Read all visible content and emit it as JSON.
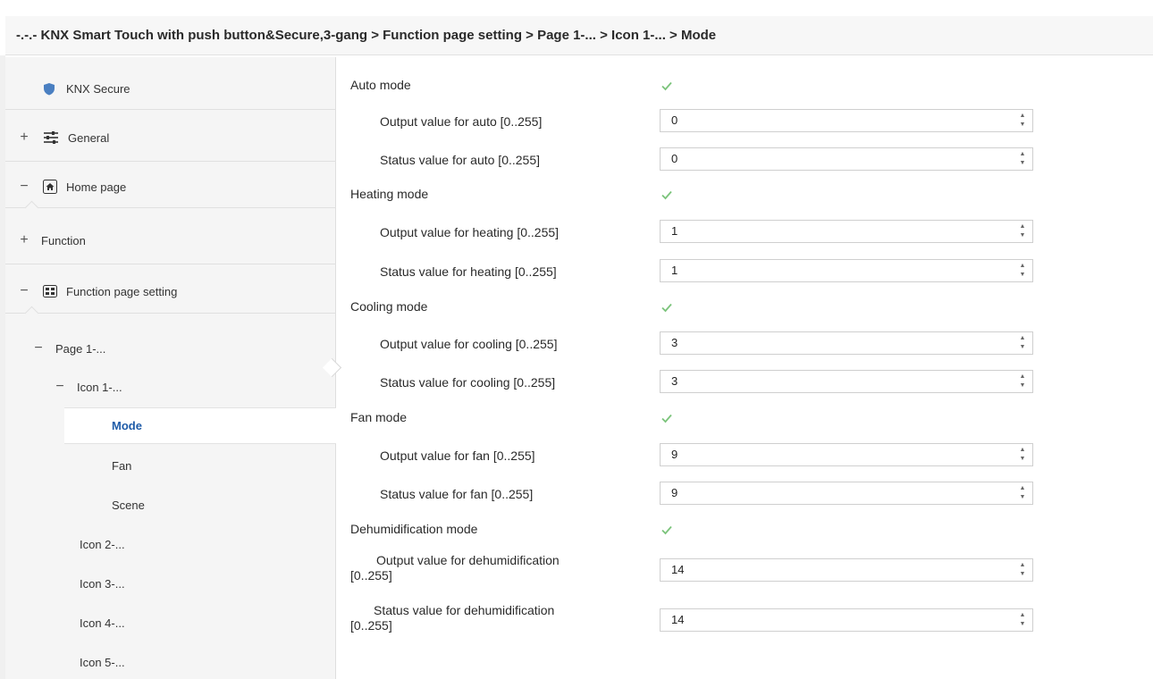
{
  "breadcrumb": "-.-.- KNX Smart Touch with push button&Secure,3-gang > Function page setting > Page 1-... > Icon 1-... > Mode",
  "sidebar": {
    "items": [
      {
        "label": "KNX Secure",
        "icon": "shield-icon",
        "toggle": ""
      },
      {
        "label": "General",
        "icon": "sliders-icon",
        "toggle": "+"
      },
      {
        "label": "Home page",
        "icon": "home-icon",
        "toggle": "−"
      },
      {
        "label": "Function",
        "icon": "",
        "toggle": "+"
      },
      {
        "label": "Function page setting",
        "icon": "grid-icon",
        "toggle": "−"
      },
      {
        "label": "Page 1-...",
        "icon": "",
        "toggle": "−"
      },
      {
        "label": "Icon 1-...",
        "icon": "",
        "toggle": "−"
      },
      {
        "label": "Mode",
        "icon": "",
        "toggle": ""
      },
      {
        "label": "Fan",
        "icon": "",
        "toggle": ""
      },
      {
        "label": "Scene",
        "icon": "",
        "toggle": ""
      },
      {
        "label": "Icon 2-...",
        "icon": "",
        "toggle": ""
      },
      {
        "label": "Icon 3-...",
        "icon": "",
        "toggle": ""
      },
      {
        "label": "Icon 4-...",
        "icon": "",
        "toggle": ""
      },
      {
        "label": "Icon 5-...",
        "icon": "",
        "toggle": ""
      }
    ]
  },
  "params": {
    "auto": {
      "label": "Auto mode",
      "checked": true,
      "output_label": "Output value for auto [0..255]",
      "output_value": "0",
      "status_label": "Status value for auto [0..255]",
      "status_value": "0"
    },
    "heating": {
      "label": "Heating mode",
      "checked": true,
      "output_label": "Output value for heating [0..255]",
      "output_value": "1",
      "status_label": "Status value for heating [0..255]",
      "status_value": "1"
    },
    "cooling": {
      "label": "Cooling mode",
      "checked": true,
      "output_label": "Output value for cooling [0..255]",
      "output_value": "3",
      "status_label": "Status value for cooling [0..255]",
      "status_value": "3"
    },
    "fan": {
      "label": "Fan mode",
      "checked": true,
      "output_label": "Output value for fan [0..255]",
      "output_value": "9",
      "status_label": "Status value for fan [0..255]",
      "status_value": "9"
    },
    "dehum": {
      "label": "Dehumidification mode",
      "checked": true,
      "output_label_1": "Output value for dehumidification",
      "output_label_2": "[0..255]",
      "output_value": "14",
      "status_label_1": "Status value for dehumidification",
      "status_label_2": "[0..255]",
      "status_value": "14"
    }
  },
  "colors": {
    "accent": "#1e5ba8",
    "check": "#7cc47c",
    "shield": "#4a7fc1"
  }
}
